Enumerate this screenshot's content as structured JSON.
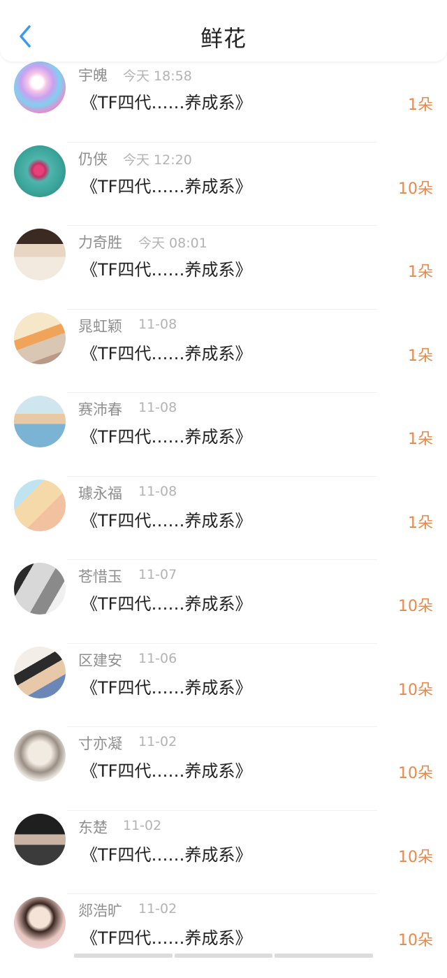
{
  "header": {
    "title": "鲜花",
    "back_icon": "chevron-left-icon",
    "accent": "#3b9be8"
  },
  "colors": {
    "count": "#e8884a",
    "name": "#8e8e8e",
    "time": "#b3b3b3"
  },
  "items": [
    {
      "name": "宇魄",
      "time": "今天 18:58",
      "book": "《TF四代……养成系》",
      "count": "1朵"
    },
    {
      "name": "仍侠",
      "time": "今天 12:20",
      "book": "《TF四代……养成系》",
      "count": "10朵"
    },
    {
      "name": "力奇胜",
      "time": "今天 08:01",
      "book": "《TF四代……养成系》",
      "count": "1朵"
    },
    {
      "name": "晁虹颖",
      "time": "11-08",
      "book": "《TF四代……养成系》",
      "count": "1朵"
    },
    {
      "name": "赛沛春",
      "time": "11-08",
      "book": "《TF四代……养成系》",
      "count": "1朵"
    },
    {
      "name": "璩永福",
      "time": "11-08",
      "book": "《TF四代……养成系》",
      "count": "1朵"
    },
    {
      "name": "苍惜玉",
      "time": "11-07",
      "book": "《TF四代……养成系》",
      "count": "10朵"
    },
    {
      "name": "区建安",
      "time": "11-06",
      "book": "《TF四代……养成系》",
      "count": "10朵"
    },
    {
      "name": "寸亦凝",
      "time": "11-02",
      "book": "《TF四代……养成系》",
      "count": "10朵"
    },
    {
      "name": "东楚",
      "time": "11-02",
      "book": "《TF四代……养成系》",
      "count": "10朵"
    },
    {
      "name": "郯浩旷",
      "time": "11-02",
      "book": "《TF四代……养成系》",
      "count": "10朵"
    }
  ]
}
